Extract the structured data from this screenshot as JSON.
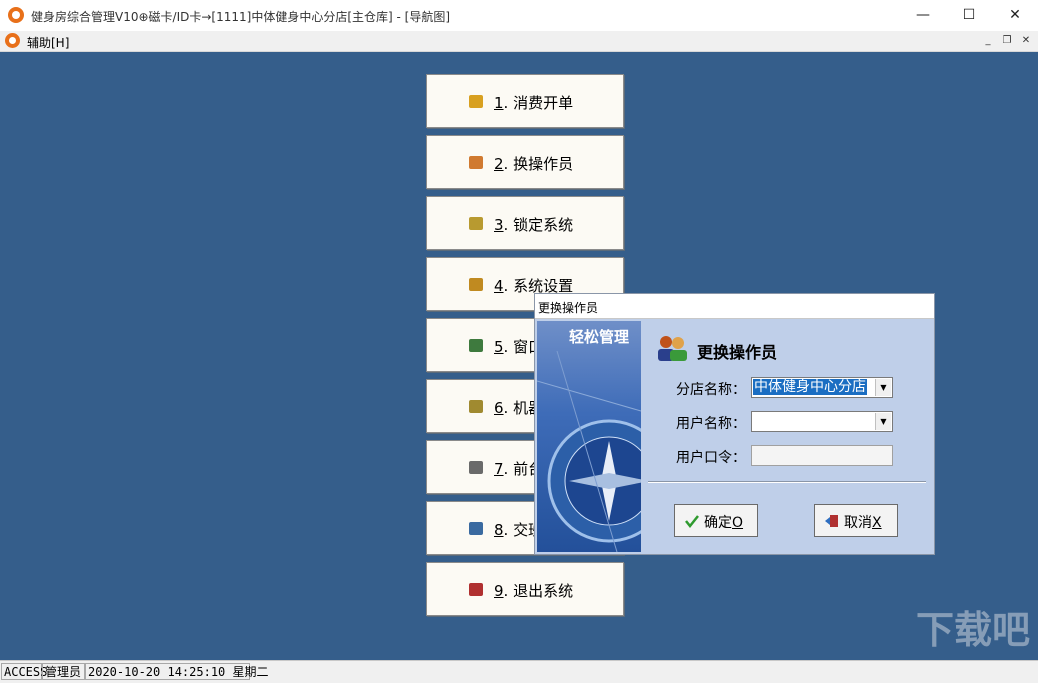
{
  "window": {
    "title": "健身房综合管理V10⊕磁卡/ID卡→[1111]中体健身中心分店[主仓库] - [导航图]",
    "minimize": "—",
    "maximize": "☐",
    "close": "✕"
  },
  "menubar": {
    "items": [
      {
        "label": "辅助[H]"
      }
    ],
    "mdi_min": "_",
    "mdi_restore": "❐",
    "mdi_close": "✕"
  },
  "nav_buttons": [
    {
      "num": "1",
      "text": ". 消费开单",
      "icon": "coins-icon"
    },
    {
      "num": "2",
      "text": ". 换操作员",
      "icon": "users-icon"
    },
    {
      "num": "3",
      "text": ". 锁定系统",
      "icon": "key-icon"
    },
    {
      "num": "4",
      "text": ". 系统设置",
      "icon": "gear-icon"
    },
    {
      "num": "5",
      "text": ". 窗口",
      "icon": "windows-icon"
    },
    {
      "num": "6",
      "text": ". 机器",
      "icon": "gears-icon"
    },
    {
      "num": "7",
      "text": ". 前台",
      "icon": "printer-icon"
    },
    {
      "num": "8",
      "text": ". 交班",
      "icon": "calculator-icon"
    },
    {
      "num": "9",
      "text": ". 退出系统",
      "icon": "exit-icon"
    }
  ],
  "dialog": {
    "title": "更换操作员",
    "banner_text": "轻松管理",
    "heading": "更换操作员",
    "store_label": "分店名称：",
    "store_value": "中体健身中心分店",
    "user_label": "用户名称：",
    "user_value": "",
    "password_label": "用户口令：",
    "password_value": "",
    "ok_label": "确定",
    "ok_key": "O",
    "cancel_label": "取消",
    "cancel_key": "X"
  },
  "statusbar": {
    "db": "ACCESS",
    "user": "管理员",
    "datetime": "2020-10-20 14:25:10 星期二"
  },
  "watermark": "下载吧",
  "colors": {
    "desktop": "#355e8b",
    "dialog": "#bfcfe9",
    "accent": "#e8701a"
  }
}
